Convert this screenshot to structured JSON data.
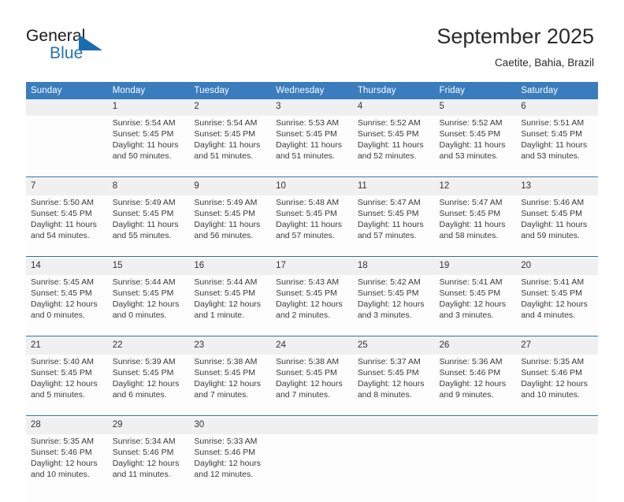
{
  "brand": {
    "name_part1": "General",
    "name_part2": "Blue",
    "logo_icon": "triangle-flag-icon"
  },
  "header": {
    "title": "September 2025",
    "location": "Caetite, Bahia, Brazil"
  },
  "calendar": {
    "weekday_headers": [
      "Sunday",
      "Monday",
      "Tuesday",
      "Wednesday",
      "Thursday",
      "Friday",
      "Saturday"
    ],
    "accent_color": "#3a7cbe",
    "separator_color": "#2e6da4",
    "daynum_band_color": "#f0f0f0",
    "weeks": [
      [
        {
          "day": "",
          "sunrise": "",
          "sunset": "",
          "daylight_line1": "",
          "daylight_line2": ""
        },
        {
          "day": "1",
          "sunrise": "Sunrise: 5:54 AM",
          "sunset": "Sunset: 5:45 PM",
          "daylight_line1": "Daylight: 11 hours",
          "daylight_line2": "and 50 minutes."
        },
        {
          "day": "2",
          "sunrise": "Sunrise: 5:54 AM",
          "sunset": "Sunset: 5:45 PM",
          "daylight_line1": "Daylight: 11 hours",
          "daylight_line2": "and 51 minutes."
        },
        {
          "day": "3",
          "sunrise": "Sunrise: 5:53 AM",
          "sunset": "Sunset: 5:45 PM",
          "daylight_line1": "Daylight: 11 hours",
          "daylight_line2": "and 51 minutes."
        },
        {
          "day": "4",
          "sunrise": "Sunrise: 5:52 AM",
          "sunset": "Sunset: 5:45 PM",
          "daylight_line1": "Daylight: 11 hours",
          "daylight_line2": "and 52 minutes."
        },
        {
          "day": "5",
          "sunrise": "Sunrise: 5:52 AM",
          "sunset": "Sunset: 5:45 PM",
          "daylight_line1": "Daylight: 11 hours",
          "daylight_line2": "and 53 minutes."
        },
        {
          "day": "6",
          "sunrise": "Sunrise: 5:51 AM",
          "sunset": "Sunset: 5:45 PM",
          "daylight_line1": "Daylight: 11 hours",
          "daylight_line2": "and 53 minutes."
        }
      ],
      [
        {
          "day": "7",
          "sunrise": "Sunrise: 5:50 AM",
          "sunset": "Sunset: 5:45 PM",
          "daylight_line1": "Daylight: 11 hours",
          "daylight_line2": "and 54 minutes."
        },
        {
          "day": "8",
          "sunrise": "Sunrise: 5:49 AM",
          "sunset": "Sunset: 5:45 PM",
          "daylight_line1": "Daylight: 11 hours",
          "daylight_line2": "and 55 minutes."
        },
        {
          "day": "9",
          "sunrise": "Sunrise: 5:49 AM",
          "sunset": "Sunset: 5:45 PM",
          "daylight_line1": "Daylight: 11 hours",
          "daylight_line2": "and 56 minutes."
        },
        {
          "day": "10",
          "sunrise": "Sunrise: 5:48 AM",
          "sunset": "Sunset: 5:45 PM",
          "daylight_line1": "Daylight: 11 hours",
          "daylight_line2": "and 57 minutes."
        },
        {
          "day": "11",
          "sunrise": "Sunrise: 5:47 AM",
          "sunset": "Sunset: 5:45 PM",
          "daylight_line1": "Daylight: 11 hours",
          "daylight_line2": "and 57 minutes."
        },
        {
          "day": "12",
          "sunrise": "Sunrise: 5:47 AM",
          "sunset": "Sunset: 5:45 PM",
          "daylight_line1": "Daylight: 11 hours",
          "daylight_line2": "and 58 minutes."
        },
        {
          "day": "13",
          "sunrise": "Sunrise: 5:46 AM",
          "sunset": "Sunset: 5:45 PM",
          "daylight_line1": "Daylight: 11 hours",
          "daylight_line2": "and 59 minutes."
        }
      ],
      [
        {
          "day": "14",
          "sunrise": "Sunrise: 5:45 AM",
          "sunset": "Sunset: 5:45 PM",
          "daylight_line1": "Daylight: 12 hours",
          "daylight_line2": "and 0 minutes."
        },
        {
          "day": "15",
          "sunrise": "Sunrise: 5:44 AM",
          "sunset": "Sunset: 5:45 PM",
          "daylight_line1": "Daylight: 12 hours",
          "daylight_line2": "and 0 minutes."
        },
        {
          "day": "16",
          "sunrise": "Sunrise: 5:44 AM",
          "sunset": "Sunset: 5:45 PM",
          "daylight_line1": "Daylight: 12 hours",
          "daylight_line2": "and 1 minute."
        },
        {
          "day": "17",
          "sunrise": "Sunrise: 5:43 AM",
          "sunset": "Sunset: 5:45 PM",
          "daylight_line1": "Daylight: 12 hours",
          "daylight_line2": "and 2 minutes."
        },
        {
          "day": "18",
          "sunrise": "Sunrise: 5:42 AM",
          "sunset": "Sunset: 5:45 PM",
          "daylight_line1": "Daylight: 12 hours",
          "daylight_line2": "and 3 minutes."
        },
        {
          "day": "19",
          "sunrise": "Sunrise: 5:41 AM",
          "sunset": "Sunset: 5:45 PM",
          "daylight_line1": "Daylight: 12 hours",
          "daylight_line2": "and 3 minutes."
        },
        {
          "day": "20",
          "sunrise": "Sunrise: 5:41 AM",
          "sunset": "Sunset: 5:45 PM",
          "daylight_line1": "Daylight: 12 hours",
          "daylight_line2": "and 4 minutes."
        }
      ],
      [
        {
          "day": "21",
          "sunrise": "Sunrise: 5:40 AM",
          "sunset": "Sunset: 5:45 PM",
          "daylight_line1": "Daylight: 12 hours",
          "daylight_line2": "and 5 minutes."
        },
        {
          "day": "22",
          "sunrise": "Sunrise: 5:39 AM",
          "sunset": "Sunset: 5:45 PM",
          "daylight_line1": "Daylight: 12 hours",
          "daylight_line2": "and 6 minutes."
        },
        {
          "day": "23",
          "sunrise": "Sunrise: 5:38 AM",
          "sunset": "Sunset: 5:45 PM",
          "daylight_line1": "Daylight: 12 hours",
          "daylight_line2": "and 7 minutes."
        },
        {
          "day": "24",
          "sunrise": "Sunrise: 5:38 AM",
          "sunset": "Sunset: 5:45 PM",
          "daylight_line1": "Daylight: 12 hours",
          "daylight_line2": "and 7 minutes."
        },
        {
          "day": "25",
          "sunrise": "Sunrise: 5:37 AM",
          "sunset": "Sunset: 5:45 PM",
          "daylight_line1": "Daylight: 12 hours",
          "daylight_line2": "and 8 minutes."
        },
        {
          "day": "26",
          "sunrise": "Sunrise: 5:36 AM",
          "sunset": "Sunset: 5:46 PM",
          "daylight_line1": "Daylight: 12 hours",
          "daylight_line2": "and 9 minutes."
        },
        {
          "day": "27",
          "sunrise": "Sunrise: 5:35 AM",
          "sunset": "Sunset: 5:46 PM",
          "daylight_line1": "Daylight: 12 hours",
          "daylight_line2": "and 10 minutes."
        }
      ],
      [
        {
          "day": "28",
          "sunrise": "Sunrise: 5:35 AM",
          "sunset": "Sunset: 5:46 PM",
          "daylight_line1": "Daylight: 12 hours",
          "daylight_line2": "and 10 minutes."
        },
        {
          "day": "29",
          "sunrise": "Sunrise: 5:34 AM",
          "sunset": "Sunset: 5:46 PM",
          "daylight_line1": "Daylight: 12 hours",
          "daylight_line2": "and 11 minutes."
        },
        {
          "day": "30",
          "sunrise": "Sunrise: 5:33 AM",
          "sunset": "Sunset: 5:46 PM",
          "daylight_line1": "Daylight: 12 hours",
          "daylight_line2": "and 12 minutes."
        },
        {
          "day": "",
          "sunrise": "",
          "sunset": "",
          "daylight_line1": "",
          "daylight_line2": ""
        },
        {
          "day": "",
          "sunrise": "",
          "sunset": "",
          "daylight_line1": "",
          "daylight_line2": ""
        },
        {
          "day": "",
          "sunrise": "",
          "sunset": "",
          "daylight_line1": "",
          "daylight_line2": ""
        },
        {
          "day": "",
          "sunrise": "",
          "sunset": "",
          "daylight_line1": "",
          "daylight_line2": ""
        }
      ]
    ]
  }
}
